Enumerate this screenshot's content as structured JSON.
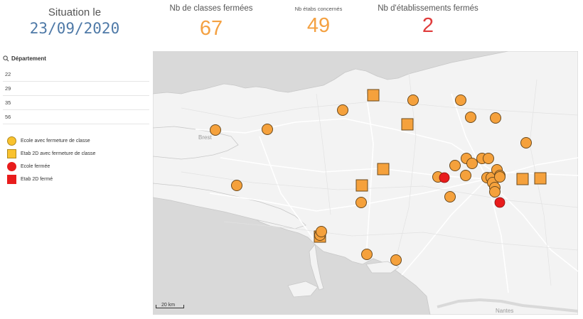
{
  "header": {
    "situation_label": "Situation le",
    "situation_date": "23/09/2020",
    "kpis": [
      {
        "label": "Nb de classes fermées",
        "value": "67",
        "color": "#f4a142"
      },
      {
        "label": "Nb étabs concernés",
        "value": "49",
        "color": "#f4a142"
      },
      {
        "label": "Nb d'établissements fermés",
        "value": "2",
        "color": "#e03c3c"
      }
    ]
  },
  "filter": {
    "title": "Département",
    "icon": "search-icon",
    "items": [
      "22",
      "29",
      "35",
      "56"
    ]
  },
  "legend": {
    "items": [
      {
        "shape": "circle",
        "color": "#f9c22e",
        "label": "Ecole avec fermeture de classe"
      },
      {
        "shape": "square",
        "color": "#f9c22e",
        "label": "Etab 2D avec fermeture de classe"
      },
      {
        "shape": "circle",
        "color": "#e81c1c",
        "label": "Ecole fermée"
      },
      {
        "shape": "square",
        "color": "#e81c1c",
        "label": "Etab 2D fermé"
      }
    ]
  },
  "map": {
    "city_labels": {
      "brest": "Brest",
      "nantes": "Nantes"
    },
    "scale": "20 km",
    "marker_colors": {
      "orange": "#f5a13c",
      "red": "#e81c1c",
      "stroke": "#6b4a1e"
    }
  }
}
